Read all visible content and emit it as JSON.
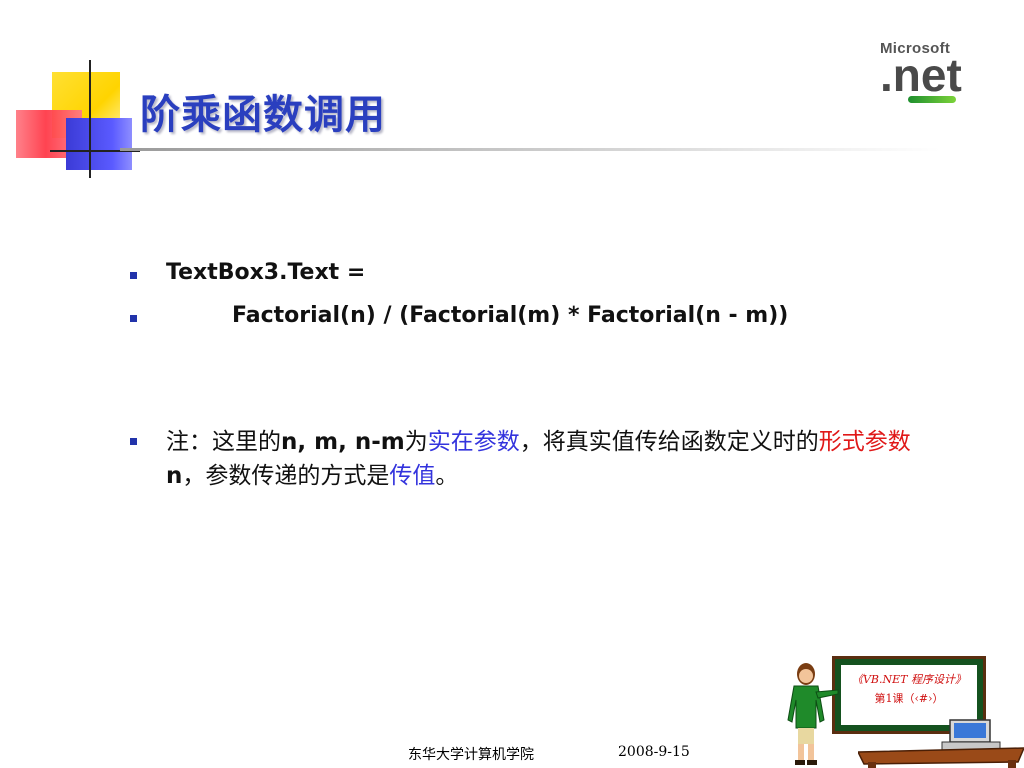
{
  "slide": {
    "title": "阶乘函数调用",
    "bullets": [
      {
        "text": "TextBox3.Text ="
      },
      {
        "text": "Factorial(n) / (Factorial(m) * Factorial(n - m))"
      }
    ],
    "note": {
      "part1": "注：这里的",
      "part2": "n, m, n-m",
      "part3": "为",
      "part4": "实在参数",
      "part5": "，将真实值传给函数定义时的",
      "part6": "形式参数",
      "part7": "n",
      "part8": "，参数传递的方式是",
      "part9": "传值",
      "part10": "。"
    }
  },
  "logo": {
    "top": "Microsoft",
    "main": ".net"
  },
  "footer": {
    "school": "东华大学计算机学院",
    "date": "2008-9-15"
  },
  "clipart": {
    "board_title": "《VB.NET 程序设计》",
    "board_lesson": "第1课（‹#›）"
  },
  "colors": {
    "title": "#2a3fbf",
    "highlight_blue": "#3333dd",
    "highlight_red": "#e01818",
    "bullet": "#2233aa"
  }
}
